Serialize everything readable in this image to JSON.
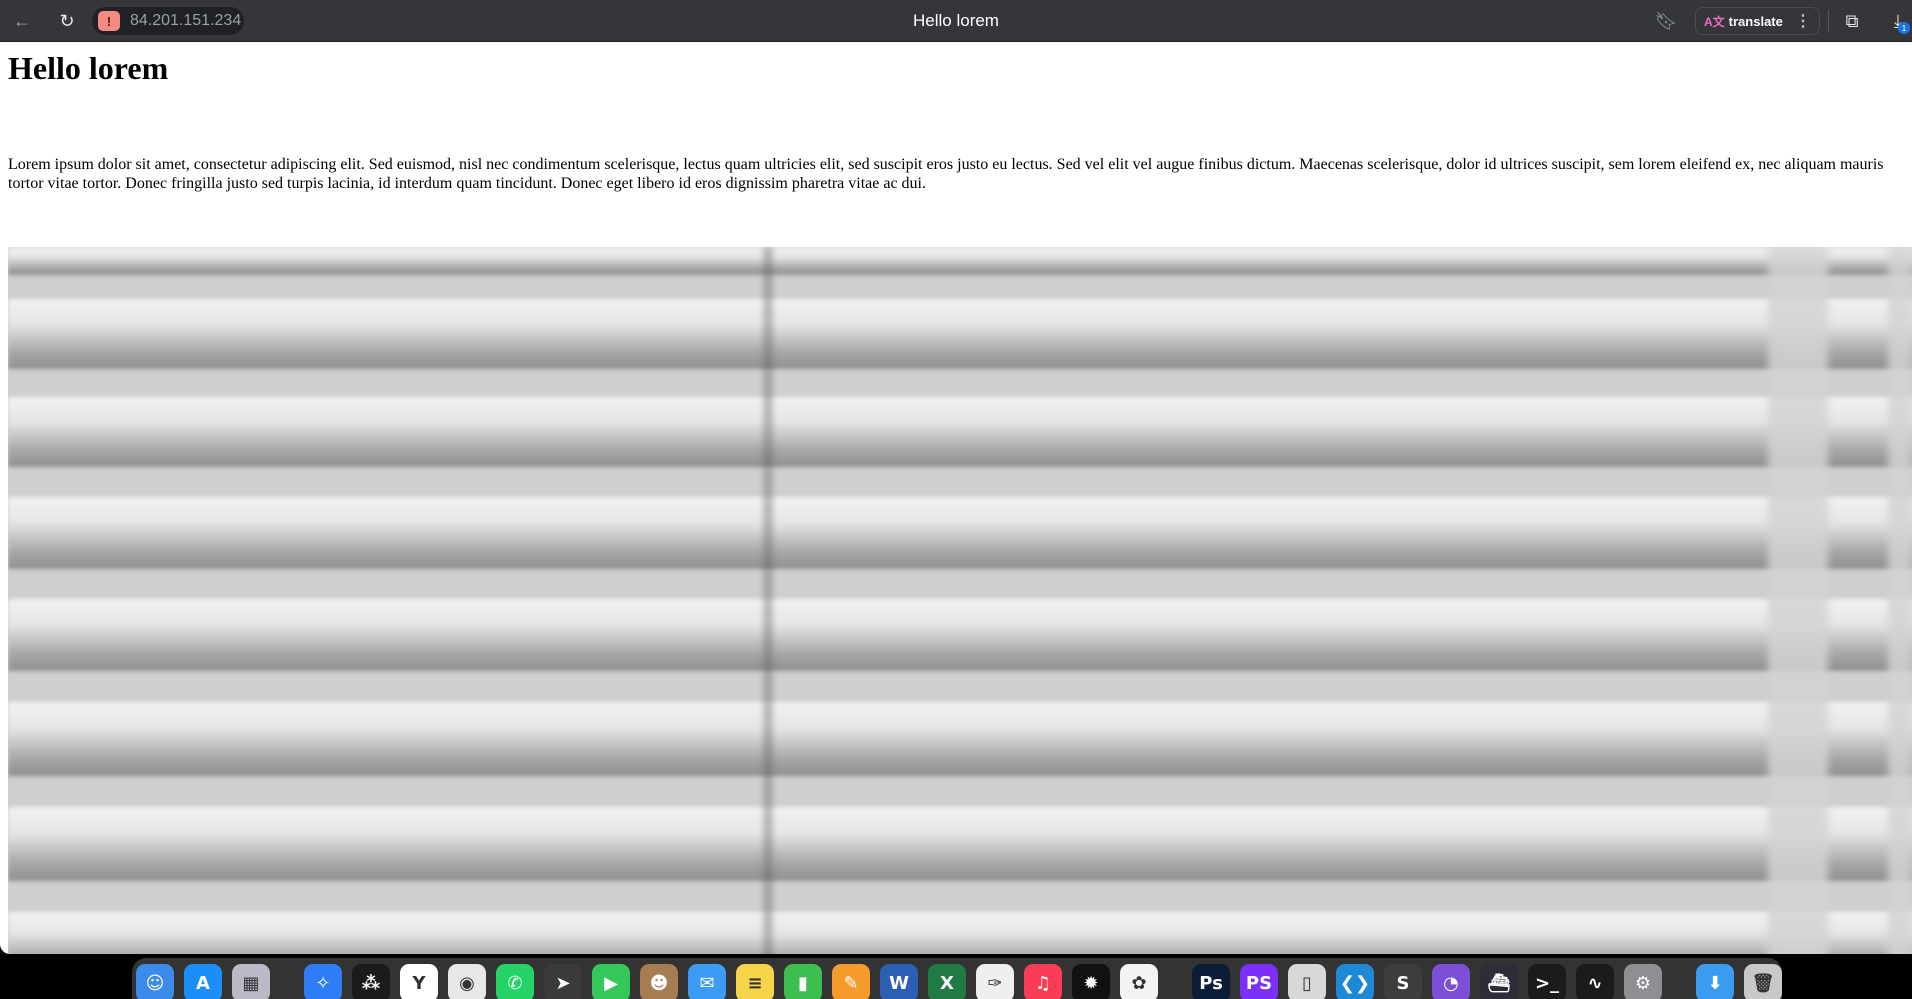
{
  "browser": {
    "address": "84.201.151.234",
    "tab_title": "Hello lorem",
    "translate_label": "translate",
    "download_count": "1"
  },
  "page": {
    "heading": "Hello lorem",
    "paragraph": "Lorem ipsum dolor sit amet, consectetur adipiscing elit. Sed euismod, nisl nec condimentum scelerisque, lectus quam ultricies elit, sed suscipit eros justo eu lectus. Sed vel elit vel augue finibus dictum. Maecenas scelerisque, dolor id ultrices suscipit, sem lorem eleifend ex, nec aliquam mauris tortor vitae tortor. Donec fringilla justo sed turpis lacinia, id interdum quam tincidunt. Donec eget libero id eros dignissim pharetra vitae ac dui."
  },
  "dock": {
    "apps": [
      {
        "name": "finder-icon",
        "color": "#3b8bea",
        "glyph": "☺"
      },
      {
        "name": "app-store-icon",
        "color": "#1c8ef9",
        "glyph": "A"
      },
      {
        "name": "launchpad-icon",
        "color": "#b9b9c8",
        "glyph": "▦"
      },
      {
        "name": "safari-icon",
        "color": "#2e7cf6",
        "glyph": "✧"
      },
      {
        "name": "perplexity-icon",
        "color": "#1b1b1b",
        "glyph": "⁂"
      },
      {
        "name": "yandex-browser-icon",
        "color": "#ffffff",
        "glyph": "Y"
      },
      {
        "name": "chrome-icon",
        "color": "#e8e8e8",
        "glyph": "◉"
      },
      {
        "name": "whatsapp-icon",
        "color": "#25d366",
        "glyph": "✆"
      },
      {
        "name": "telegram-icon",
        "color": "#3a3a3a",
        "glyph": "➤"
      },
      {
        "name": "facetime-icon",
        "color": "#34c759",
        "glyph": "▶"
      },
      {
        "name": "contacts-icon",
        "color": "#a67c52",
        "glyph": "☻"
      },
      {
        "name": "mail-icon",
        "color": "#3c9bf5",
        "glyph": "✉"
      },
      {
        "name": "notes-icon",
        "color": "#f7d54a",
        "glyph": "≡"
      },
      {
        "name": "numbers-icon",
        "color": "#3dbf4f",
        "glyph": "▮"
      },
      {
        "name": "pages-icon",
        "color": "#f59b2b",
        "glyph": "✎"
      },
      {
        "name": "word-icon",
        "color": "#2b5fb4",
        "glyph": "W"
      },
      {
        "name": "excel-icon",
        "color": "#1f7a44",
        "glyph": "X"
      },
      {
        "name": "textedit-icon",
        "color": "#efefef",
        "glyph": "✑"
      },
      {
        "name": "music-icon",
        "color": "#fa3d55",
        "glyph": "♫"
      },
      {
        "name": "spark-icon",
        "color": "#111111",
        "glyph": "✹"
      },
      {
        "name": "photos-icon",
        "color": "#f3f3f3",
        "glyph": "✿"
      },
      {
        "name": "photoshop-icon",
        "color": "#0b1c37",
        "glyph": "Ps"
      },
      {
        "name": "phpstorm-icon",
        "color": "#7b2ff7",
        "glyph": "PS"
      },
      {
        "name": "terminal-window-icon",
        "color": "#d8d8d8",
        "glyph": "▯"
      },
      {
        "name": "vscode-icon",
        "color": "#1e8ad6",
        "glyph": "❮❯"
      },
      {
        "name": "sublime-icon",
        "color": "#3d3d3d",
        "glyph": "S"
      },
      {
        "name": "github-desktop-icon",
        "color": "#7b4fd6",
        "glyph": "◔"
      },
      {
        "name": "docker-icon",
        "color": "#2d2d3a",
        "glyph": "⛴"
      },
      {
        "name": "terminal-icon",
        "color": "#1b1b1b",
        "glyph": ">_"
      },
      {
        "name": "activity-monitor-icon",
        "color": "#1b1b1b",
        "glyph": "∿"
      },
      {
        "name": "system-settings-icon",
        "color": "#8e8e93",
        "glyph": "⚙"
      },
      {
        "name": "downloads-folder-icon",
        "color": "#3a9bf0",
        "glyph": "⬇"
      },
      {
        "name": "trash-icon",
        "color": "#c8c8c8",
        "glyph": "🗑"
      }
    ]
  }
}
